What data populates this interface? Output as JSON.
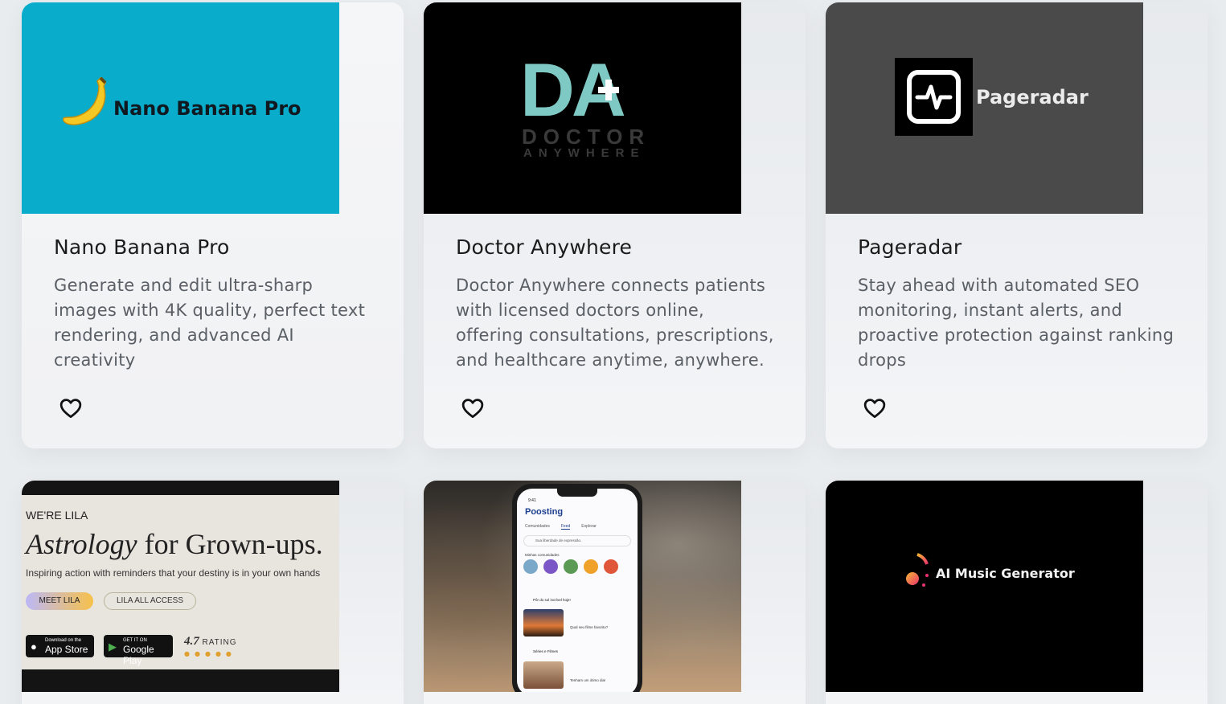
{
  "cards": [
    {
      "title": "Nano Banana Pro",
      "description": "Generate and edit ultra-sharp images with 4K quality, perfect text rendering, and advanced AI creativity",
      "thumbnail": {
        "brand_text": "Nano Banana Pro",
        "bg_color": "#09adcb",
        "icon": "banana-icon"
      }
    },
    {
      "title": "Doctor Anywhere",
      "description": "Doctor Anywhere connects patients with licensed doctors online, offering consultations, prescriptions, and healthcare anytime, anywhere.",
      "thumbnail": {
        "logo_text": "DA",
        "line1": "DOCTOR",
        "line2": "ANYWHERE",
        "bg_color": "#000000",
        "accent_color": "#7fc9c4"
      }
    },
    {
      "title": "Pageradar",
      "description": "Stay ahead with automated SEO monitoring, instant alerts, and proactive protection against ranking drops",
      "thumbnail": {
        "brand_text": "Pageradar",
        "bg_color": "#4a4a4a",
        "icon": "pulse-icon"
      }
    },
    {
      "thumbnail": {
        "kicker": "WE'RE LILA",
        "headline_italic": "Astrology",
        "headline_rest": " for Grown-ups.",
        "tagline": "Inspiring action with reminders that your destiny is in your own hands",
        "primary_button": "MEET LILA",
        "secondary_button": "LILA ALL ACCESS",
        "appstore_small": "Download on the",
        "appstore_big": "App Store",
        "googleplay_small": "GET IT ON",
        "googleplay_big": "Google Play",
        "rating_value": "4.7",
        "rating_label": "RATING"
      }
    },
    {
      "thumbnail": {
        "time": "9:41",
        "app_name": "Poosting",
        "tabs": [
          "Comunidades",
          "Feed",
          "Explorar"
        ],
        "compose_placeholder": "Sua liberdade de expressão.",
        "section_label": "Minhas comunidades",
        "post1_title": "Pôr do sol incrível hoje!",
        "post1_caption": "Qual seu filme favorito?",
        "post2_title": "Séries e Filmes",
        "post2_caption": "Tenham um ótimo dia!"
      }
    },
    {
      "thumbnail": {
        "brand_text": "AI Music Generator",
        "bg_color": "#000000",
        "icon": "music-note-icon"
      }
    }
  ],
  "actions": {
    "favorite_icon": "heart-outline-icon"
  }
}
